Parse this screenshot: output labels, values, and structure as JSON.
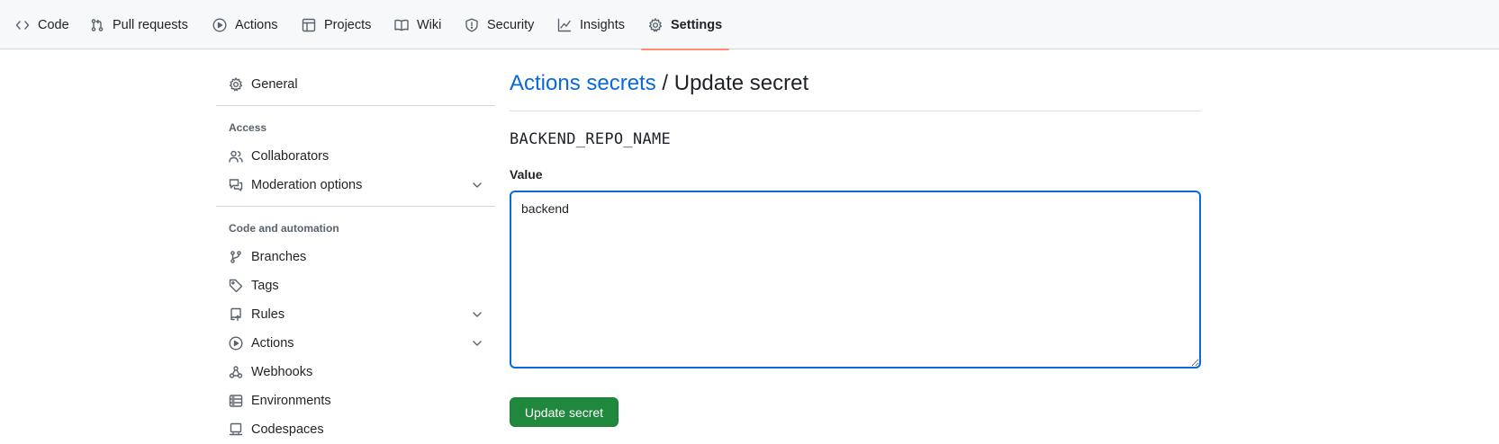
{
  "repo_nav": {
    "tabs": [
      {
        "label": "Code",
        "icon": "code-icon"
      },
      {
        "label": "Pull requests",
        "icon": "git-pull-request-icon"
      },
      {
        "label": "Actions",
        "icon": "play-circle-icon"
      },
      {
        "label": "Projects",
        "icon": "table-icon"
      },
      {
        "label": "Wiki",
        "icon": "book-icon"
      },
      {
        "label": "Security",
        "icon": "shield-icon"
      },
      {
        "label": "Insights",
        "icon": "graph-icon"
      },
      {
        "label": "Settings",
        "icon": "gear-icon",
        "active": true
      }
    ],
    "active_underline_color": "#fd8c73"
  },
  "sidebar": {
    "general": "General",
    "access_heading": "Access",
    "collaborators": "Collaborators",
    "moderation": "Moderation options",
    "code_automation_heading": "Code and automation",
    "branches": "Branches",
    "tags": "Tags",
    "rules": "Rules",
    "actions": "Actions",
    "webhooks": "Webhooks",
    "environments": "Environments",
    "codespaces": "Codespaces"
  },
  "page": {
    "breadcrumb_link": "Actions secrets",
    "separator": " / ",
    "title": "Update secret",
    "secret_name": "BACKEND_REPO_NAME",
    "value_label": "Value",
    "value": "backend",
    "submit_label": "Update secret",
    "link_color": "#0969da",
    "focus_color": "#0969da",
    "button_color": "#1f883d"
  }
}
